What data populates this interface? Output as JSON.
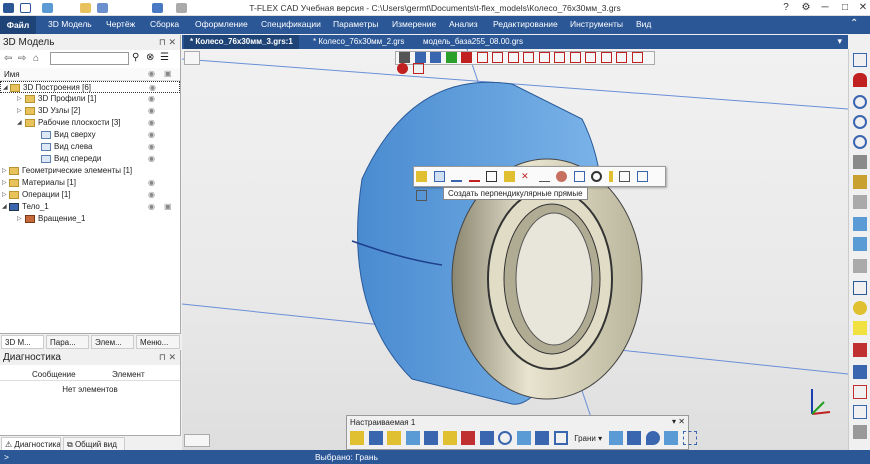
{
  "window": {
    "title": "T-FLEX CAD Учебная версия - C:\\Users\\germt\\Documents\\t-flex_models\\Колесо_76x30мм_3.grs"
  },
  "menu": {
    "items": [
      "Файл",
      "3D Модель",
      "Чертёж",
      "Сборка",
      "Оформление",
      "Спецификации",
      "Параметры",
      "Измерение",
      "Анализ",
      "Редактирование",
      "Инструменты",
      "Вид"
    ]
  },
  "model_panel": {
    "title": "3D Модель",
    "search_placeholder": "",
    "column_header": "Имя",
    "tree": [
      {
        "label": "3D Построения [6]",
        "level": 0,
        "expanded": true,
        "kind": "folder",
        "selected": true
      },
      {
        "label": "3D Профили [1]",
        "level": 1,
        "expanded": false,
        "kind": "folder"
      },
      {
        "label": "3D Узлы [2]",
        "level": 1,
        "expanded": false,
        "kind": "folder"
      },
      {
        "label": "Рабочие плоскости [3]",
        "level": 1,
        "expanded": true,
        "kind": "folder"
      },
      {
        "label": "Вид сверху",
        "level": 2,
        "kind": "plane"
      },
      {
        "label": "Вид слева",
        "level": 2,
        "kind": "plane"
      },
      {
        "label": "Вид спереди",
        "level": 2,
        "kind": "plane"
      },
      {
        "label": "Геометрические элементы [1]",
        "level": 0,
        "expanded": false,
        "kind": "folder"
      },
      {
        "label": "Материалы [1]",
        "level": 0,
        "expanded": false,
        "kind": "folder"
      },
      {
        "label": "Операции [1]",
        "level": 0,
        "expanded": false,
        "kind": "folder"
      },
      {
        "label": "Тело_1",
        "level": 0,
        "expanded": true,
        "kind": "body"
      },
      {
        "label": "Вращение_1",
        "level": 1,
        "expanded": false,
        "kind": "operation"
      }
    ],
    "bottom_tabs": [
      "3D М...",
      "Пара...",
      "Элем...",
      "Меню..."
    ]
  },
  "diagnostics": {
    "title": "Диагностика",
    "columns": [
      "Сообщение",
      "Элемент"
    ],
    "empty_text": "Нет элементов",
    "tabs": [
      "Диагностика",
      "Общий вид"
    ]
  },
  "doc_tabs": [
    {
      "label": "* Колесо_76x30мм_3.grs:1",
      "active": true
    },
    {
      "label": "* Колесо_76x30мм_2.grs",
      "active": false
    },
    {
      "label": "модель_база255_08.00.grs",
      "active": false
    }
  ],
  "context_toolbar": {
    "tooltip": "Создать перпендикулярные прямые"
  },
  "custom_toolbar": {
    "title": "Настраиваемая 1",
    "faces_label": "Грани"
  },
  "status": {
    "prompt": ">",
    "selection": "Выбрано: Грань"
  },
  "colors": {
    "menubar": "#2b5797",
    "selection_face": "#5b9bd5",
    "tire": "#d4cfb0"
  }
}
